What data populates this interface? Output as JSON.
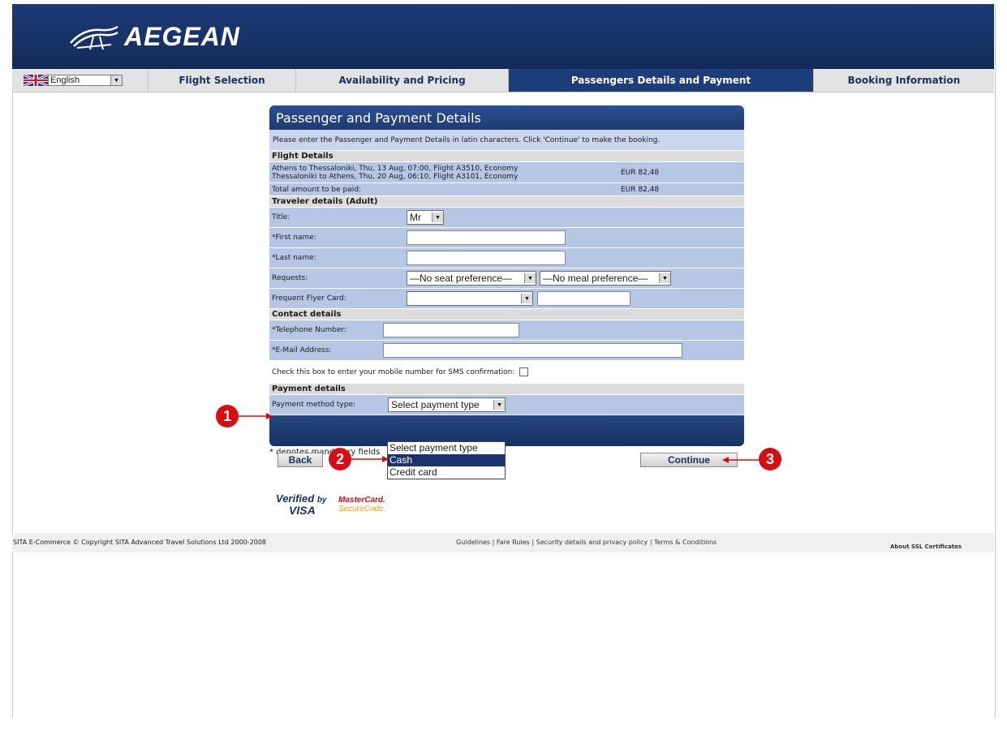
{
  "brand": {
    "name": "AEGEAN"
  },
  "nav": {
    "language": "English",
    "tabs": [
      {
        "label": "Flight Selection",
        "active": false
      },
      {
        "label": "Availability and Pricing",
        "active": false
      },
      {
        "label": "Passengers Details and Payment",
        "active": true
      },
      {
        "label": "Booking Information",
        "active": false
      }
    ]
  },
  "panel": {
    "title": "Passenger and Payment Details",
    "intro": "Please enter the Passenger and Payment Details in latin characters. Click 'Continue' to make the booking.",
    "flight": {
      "heading": "Flight Details",
      "line1": "Athens to Thessaloniki, Thu, 13 Aug, 07:00, Flight A3510, Economy",
      "line2": "Thessaloniki to Athens, Thu, 20 Aug, 06:10, Flight A3101, Economy",
      "price": "EUR 82,48",
      "total_label": "Total amount to be paid:",
      "total_value": "EUR 82,48"
    },
    "traveler": {
      "heading": "Traveler details (Adult)",
      "title_label": "Title:",
      "title_value": "Mr",
      "first_label": "*First name:",
      "last_label": "*Last name:",
      "requests_label": "Requests:",
      "seat_value": "—No seat preference—",
      "meal_value": "—No meal preference—",
      "ffc_label": "Frequent Flyer Card:"
    },
    "contact": {
      "heading": "Contact details",
      "phone_label": "*Telephone Number:",
      "email_label": "*E-Mail Address:",
      "sms_label": "Check this box to enter your mobile number for SMS confirmation:"
    },
    "payment": {
      "heading": "Payment details",
      "method_label": "Payment method type:",
      "method_value": "Select payment type",
      "options": [
        "Select payment type",
        "Cash",
        "Credit card"
      ],
      "highlighted": "Cash"
    },
    "buttons": {
      "back": "Back",
      "continue": "Continue"
    },
    "mandatory_note": "* denotes mandatory fields"
  },
  "badges": {
    "visa_top": "Verified",
    "visa_by": "by",
    "visa_bottom": "VISA",
    "mc_top": "MasterCard.",
    "mc_bottom": "SecureCode."
  },
  "footer": {
    "copyright": "SITA E-Commerce © Copyright SITA Advanced Travel Solutions Ltd 2000-2008",
    "links": [
      "Guidelines",
      "Fare Rules",
      "Security details and privacy policy",
      "Terms & Conditions"
    ],
    "ssl": "About SSL Certificates"
  },
  "callouts": [
    "1",
    "2",
    "3"
  ],
  "colors": {
    "brand_blue": "#1d3d7a",
    "callout_red": "#d80d12",
    "row_blue": "#b6c7e6"
  }
}
